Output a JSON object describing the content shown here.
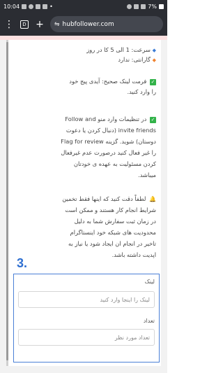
{
  "status_bar": {
    "time": "10:04",
    "battery": "7%"
  },
  "browser": {
    "tab_count": "D",
    "url": "hubfollower.com"
  },
  "content": {
    "speed_line": "سرعت: 1 الی 5 کا در روز",
    "warranty_line": "گارانتی: ندارد",
    "link_format_lines": [
      "فرمت لینک صحیح: آیدی پیج خود",
      "را وارد کنید."
    ],
    "follow_lines": [
      "در تنظیمات وارد منو Follow and",
      "invite friends (دنبال کردن یا دعوت",
      "دوستان) شوید. گزینه Flag for review",
      "را غیر فعال کنید درصورت عدم غیرفعال",
      "کردن مسئولیت به عهده ی خودتان",
      "میباشد."
    ],
    "notice_lines": [
      "لطفاً دقت کنید که اینها فقط تخمین",
      "شرایط انجام کار هستند و ممکن است",
      "در زمان ثبت سفارش شما به دلیل",
      "محدودیت های شبکه خود اینستاگرام",
      "تاخیر در انجام ان ایجاد شود یا نیاز به",
      "اپدیت داشته باشد."
    ]
  },
  "step_number": "3.",
  "form": {
    "link_label": "لینک",
    "link_placeholder": "لینک را اینجا وارد کنید",
    "quantity_label": "تعداد",
    "quantity_placeholder": "تعداد مورد نظر"
  }
}
